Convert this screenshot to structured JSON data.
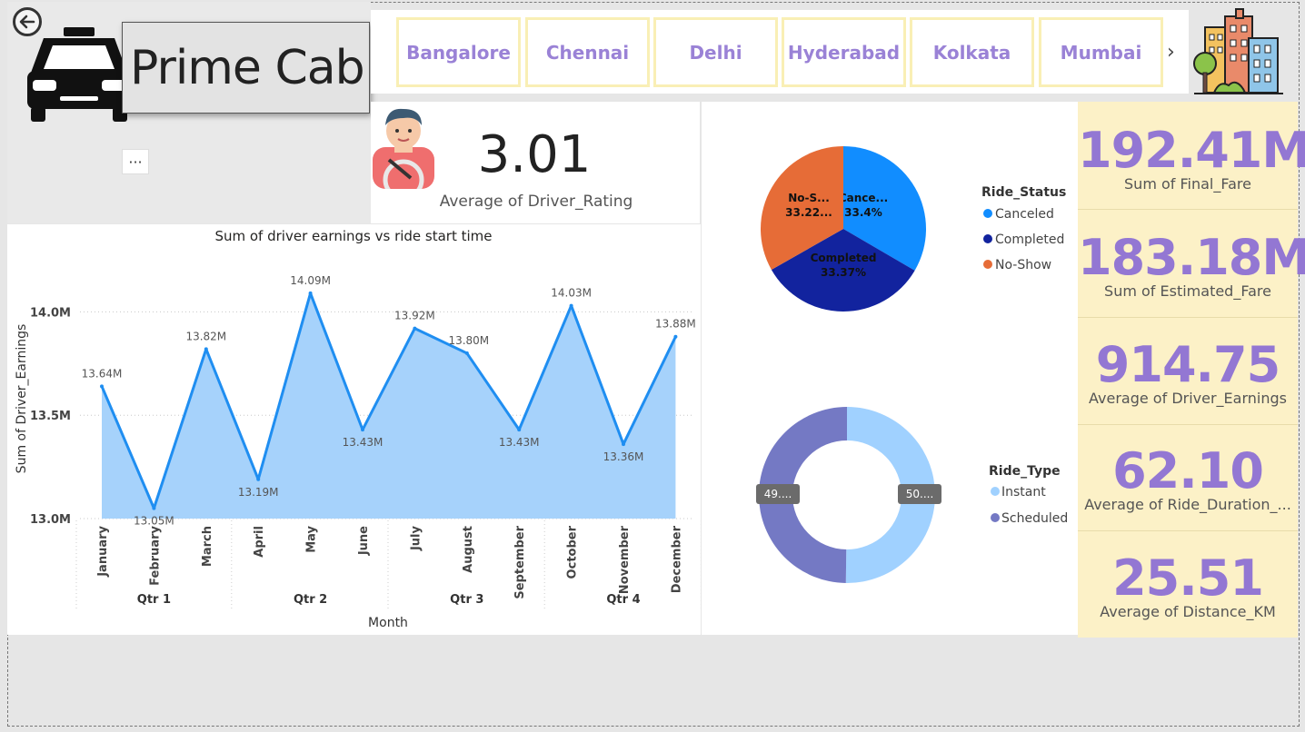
{
  "app": {
    "title": "Prime Cab",
    "more_label": "···"
  },
  "cities": [
    "Bangalore",
    "Chennai",
    "Delhi",
    "Hyderabad",
    "Kolkata",
    "Mumbai"
  ],
  "rating": {
    "value": "3.01",
    "label": "Average of Driver_Rating"
  },
  "kpis": [
    {
      "value": "192.41M",
      "label": "Sum of Final_Fare"
    },
    {
      "value": "183.18M",
      "label": "Sum of Estimated_Fare"
    },
    {
      "value": "914.75",
      "label": "Average of Driver_Earnings"
    },
    {
      "value": "62.10",
      "label": "Average of Ride_Duration_..."
    },
    {
      "value": "25.51",
      "label": "Average of Distance_KM"
    }
  ],
  "colors": {
    "area_fill": "#a6d2fb",
    "line": "#1f8ef1",
    "kpi_text": "#9377d3",
    "kpi_bg": "#fcf1c7",
    "canceled": "#118dff",
    "completed": "#12239e",
    "noshow": "#e66c37",
    "instant": "#a0d1ff",
    "scheduled": "#7479c4"
  },
  "chart_data": [
    {
      "type": "area",
      "title": "Sum of driver earnings vs ride start time",
      "xlabel": "Month",
      "ylabel": "Sum of Driver_Earnings",
      "categories": [
        "January",
        "February",
        "March",
        "April",
        "May",
        "June",
        "July",
        "August",
        "September",
        "October",
        "November",
        "December"
      ],
      "quarters": [
        "Qtr 1",
        "Qtr 2",
        "Qtr 3",
        "Qtr 4"
      ],
      "values": [
        13.64,
        13.05,
        13.82,
        13.19,
        14.09,
        13.43,
        13.92,
        13.8,
        13.43,
        14.03,
        13.36,
        13.88
      ],
      "data_labels": [
        "13.64M",
        "13.05M",
        "13.82M",
        "13.19M",
        "14.09M",
        "13.43M",
        "13.92M",
        "13.80M",
        "13.43M",
        "14.03M",
        "13.36M",
        "13.88M"
      ],
      "yticks": [
        "13.0M",
        "13.5M",
        "14.0M"
      ],
      "ytick_values": [
        13.0,
        13.5,
        14.0
      ],
      "ylim": [
        13.0,
        14.16
      ],
      "grid": true
    },
    {
      "type": "pie",
      "legend_title": "Ride_Status",
      "legend_position": "right",
      "slices": [
        {
          "name": "Canceled",
          "value": 33.4,
          "label": "Cance...",
          "pct": "33.4%"
        },
        {
          "name": "Completed",
          "value": 33.37,
          "label": "Completed",
          "pct": "33.37%"
        },
        {
          "name": "No-Show",
          "value": 33.22,
          "label": "No-S...",
          "pct": "33.22..."
        }
      ]
    },
    {
      "type": "pie",
      "subtype": "donut",
      "legend_title": "Ride_Type",
      "legend_position": "right",
      "slices": [
        {
          "name": "Instant",
          "value": 50.2,
          "label": "50...."
        },
        {
          "name": "Scheduled",
          "value": 49.8,
          "label": "49...."
        }
      ]
    }
  ]
}
